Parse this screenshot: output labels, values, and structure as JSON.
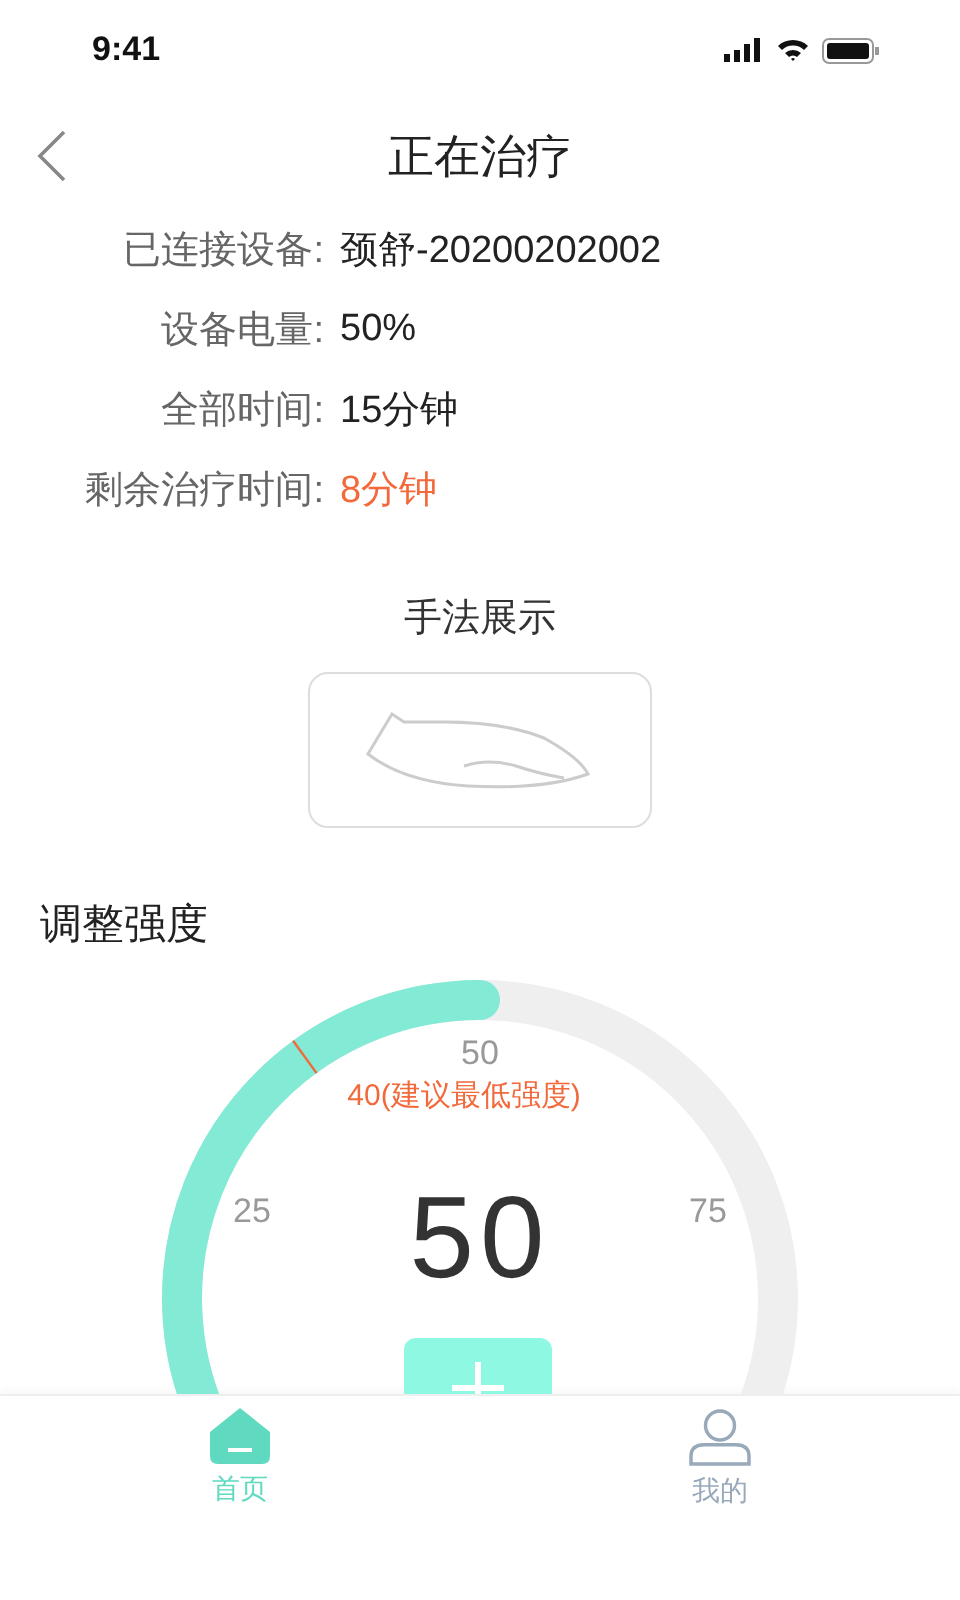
{
  "status_bar": {
    "time": "9:41"
  },
  "header": {
    "title": "正在治疗"
  },
  "info_rows": [
    {
      "label": "已连接设备:",
      "value": "颈舒-20200202002",
      "highlighted": false
    },
    {
      "label": "设备电量:",
      "value": "50%",
      "highlighted": false
    },
    {
      "label": "全部时间:",
      "value": "15分钟",
      "highlighted": false
    },
    {
      "label": "剩余治疗时间:",
      "value": "8分钟",
      "highlighted": true
    }
  ],
  "technique": {
    "title": "手法展示"
  },
  "intensity": {
    "title": "调整强度",
    "reading": "50",
    "scale_labels": [
      "25",
      "50",
      "75"
    ],
    "min_marker": {
      "label": "40(建议最低强度)"
    }
  },
  "tabs": [
    {
      "label": "首页",
      "selected": true
    },
    {
      "label": "我的",
      "selected": false
    }
  ]
}
